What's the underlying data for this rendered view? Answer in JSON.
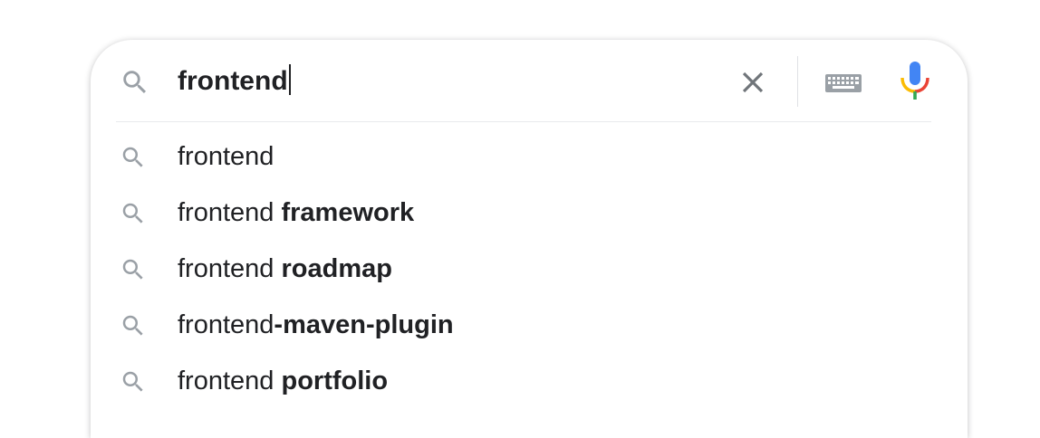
{
  "search": {
    "query": "frontend",
    "icon": "search-icon",
    "clear_icon": "close-icon",
    "keyboard_icon": "keyboard-icon",
    "mic_icon": "microphone-icon"
  },
  "suggestions": [
    {
      "prefix": "frontend",
      "completion": ""
    },
    {
      "prefix": "frontend ",
      "completion": "framework"
    },
    {
      "prefix": "frontend ",
      "completion": "roadmap"
    },
    {
      "prefix": "frontend",
      "completion": "-maven-plugin"
    },
    {
      "prefix": "frontend ",
      "completion": "portfolio"
    }
  ],
  "colors": {
    "icon_gray": "#9aa0a6",
    "text": "#202124",
    "mic_blue": "#4285f4",
    "mic_red": "#ea4335",
    "mic_yellow": "#fbbc04",
    "mic_green": "#34a853"
  }
}
